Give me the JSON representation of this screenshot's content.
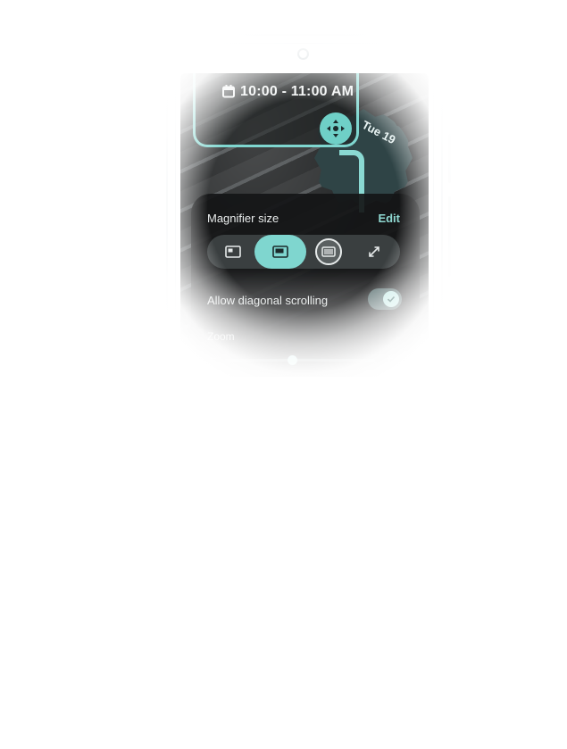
{
  "calendar_event": {
    "time_range": "10:00 - 11:00 AM",
    "icon": "calendar-icon"
  },
  "clock_widget": {
    "date_label": "Tue 19"
  },
  "magnifier_panel": {
    "title": "Magnifier size",
    "edit_label": "Edit",
    "size_options": [
      {
        "icon": "magnifier-small-window-icon",
        "selected": false
      },
      {
        "icon": "magnifier-half-screen-icon",
        "selected": true
      },
      {
        "icon": "magnifier-full-screen-icon",
        "selected": false
      },
      {
        "icon": "expand-arrows-icon",
        "selected": false
      }
    ],
    "diagonal_scrolling": {
      "label": "Allow diagonal scrolling",
      "enabled": true
    },
    "zoom": {
      "label": "Zoom",
      "minus_label": "−",
      "plus_label": "+",
      "level_fraction": 0.45
    }
  },
  "colors": {
    "accent": "#7fd6cf",
    "panel_bg": "#141617",
    "toggle_knob": "#bfe9e5"
  }
}
